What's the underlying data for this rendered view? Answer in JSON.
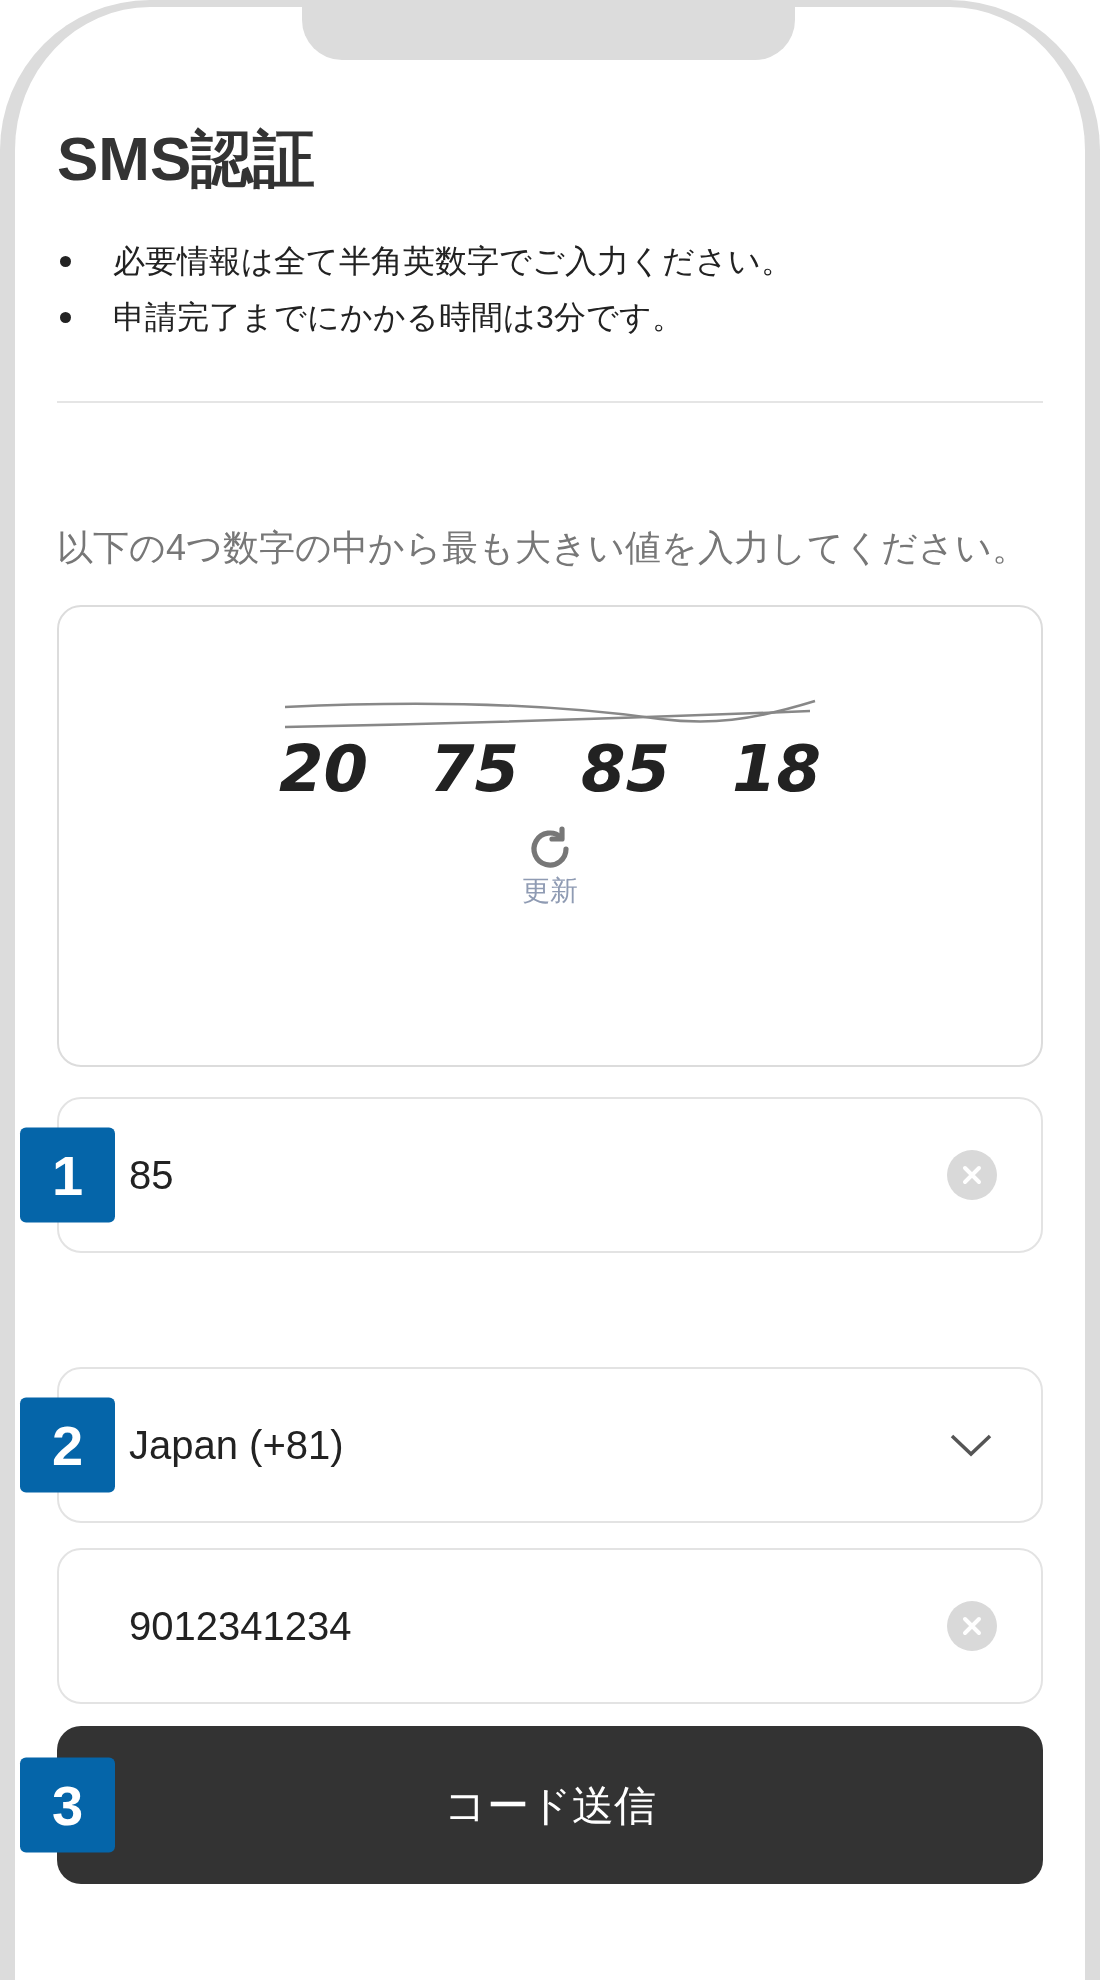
{
  "title": "SMS認証",
  "notes": [
    "必要情報は全て半角英数字でご入力ください。",
    "申請完了までにかかる時間は3分です。"
  ],
  "instruction": "以下の4つ数字の中から最も大きい値を入力してください。",
  "captcha": {
    "numbers": [
      "20",
      "75",
      "85",
      "18"
    ],
    "refresh_label": "更新"
  },
  "fields": [
    {
      "kind": "input",
      "badge": "1",
      "value": "85"
    },
    {
      "kind": "select",
      "badge": "2",
      "value": "Japan (+81)"
    },
    {
      "kind": "input",
      "value": "9012341234"
    }
  ],
  "submit": {
    "badge": "3",
    "label": "コード送信"
  }
}
